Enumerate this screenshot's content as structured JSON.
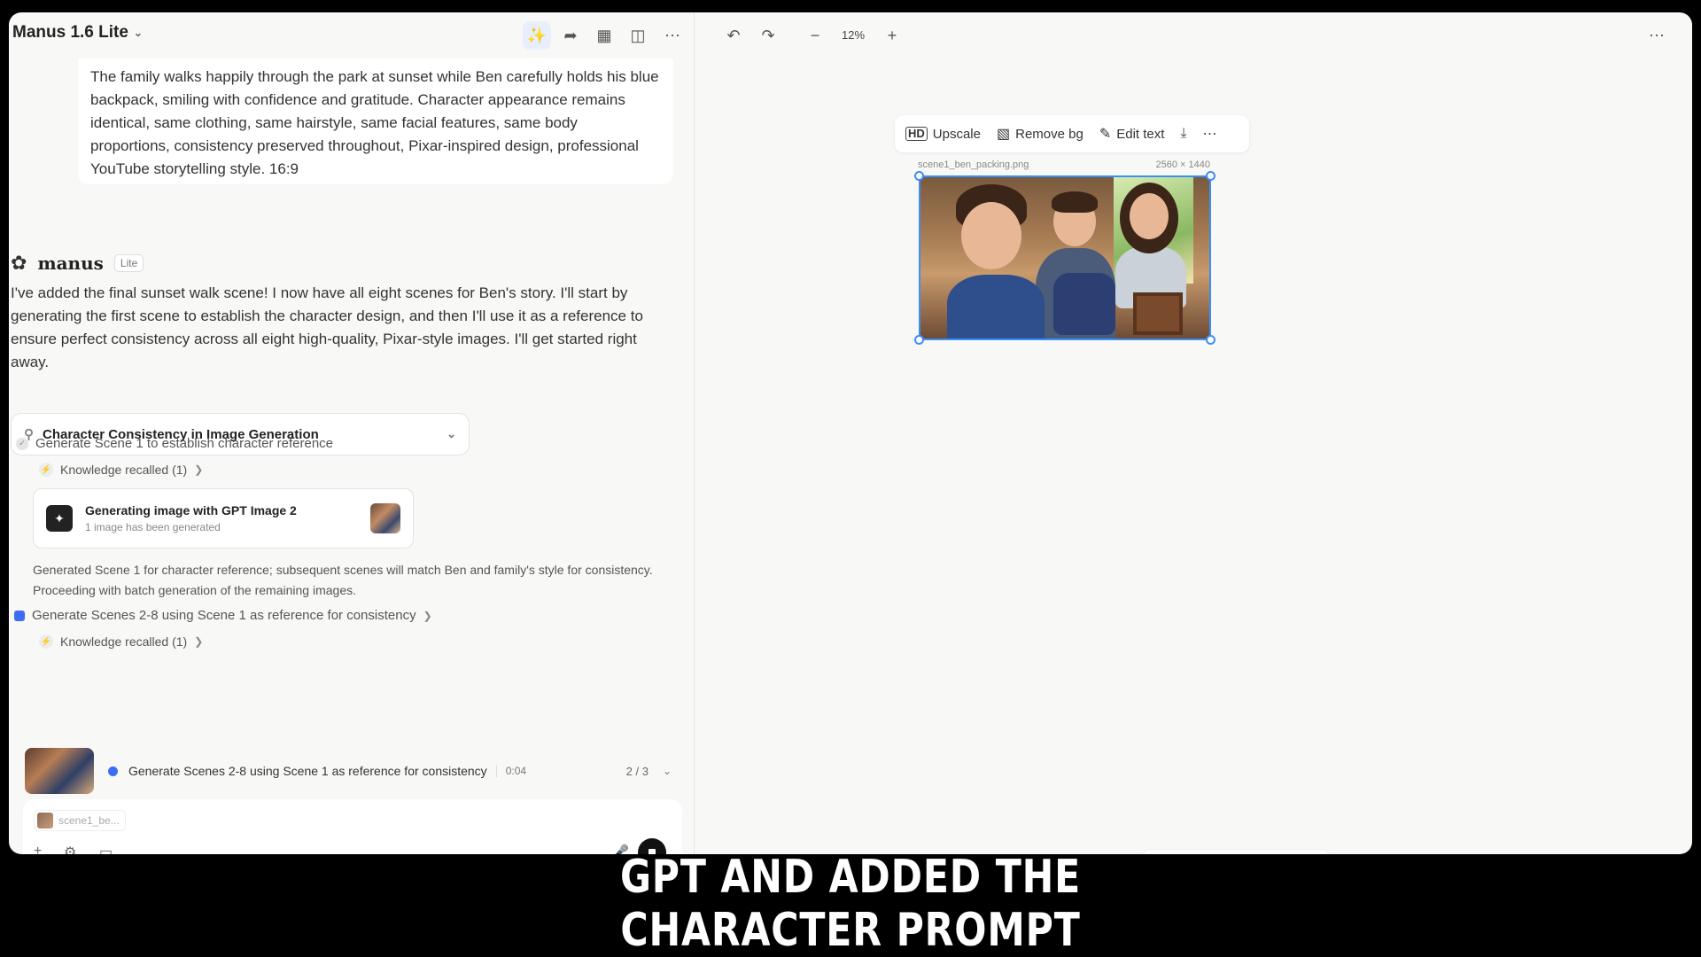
{
  "window": {
    "title": "Manus 1.6 Lite",
    "zoom": "12%"
  },
  "chat": {
    "user_message": "The family walks happily through the park at sunset while Ben carefully holds his blue backpack, smiling with confidence and gratitude. Character appearance remains identical, same clothing, same hairstyle, same facial features, same body proportions, consistency preserved throughout, Pixar-inspired design, professional YouTube storytelling style. 16:9",
    "assistant_name": "manus",
    "assistant_badge": "Lite",
    "assistant_message": "I've added the final sunset walk scene! I now have all eight scenes for Ben's story. I'll start by generating the first scene to establish the character design, and then I'll use it as a reference to ensure perfect consistency across all eight high-quality, Pixar-style images. I'll get started right away.",
    "task_title": "Character Consistency in Image Generation",
    "steps": [
      {
        "label": "Generate Scene 1 to establish character reference",
        "status": "done"
      },
      {
        "label": "Generate Scenes 2-8 using Scene 1 as reference for consistency",
        "status": "active"
      }
    ],
    "knowledge_label": "Knowledge recalled (1)",
    "generation": {
      "title": "Generating image with GPT Image 2",
      "subtitle": "1 image has been generated"
    },
    "note": "Generated Scene 1 for character reference; subsequent scenes will match Ben and family's style for consistency. Proceeding with batch generation of the remaining images."
  },
  "status": {
    "text": "Generate Scenes 2-8 using Scene 1 as reference for consistency",
    "time": "0:04",
    "page": "2 / 3"
  },
  "composer": {
    "attachment": "scene1_be..."
  },
  "canvas": {
    "toolbar": {
      "upscale": "Upscale",
      "upscale_icon": "HD",
      "remove_bg": "Remove bg",
      "edit_text": "Edit text"
    },
    "image": {
      "filename": "scene1_ben_packing.png",
      "dimensions": "2560 × 1440"
    }
  },
  "caption": {
    "line1": "GPT AND ADDED THE",
    "line2": "CHARACTER PROMPT"
  },
  "colors": {
    "accent": "#3b6ef5",
    "selection": "#3b8ef5"
  }
}
